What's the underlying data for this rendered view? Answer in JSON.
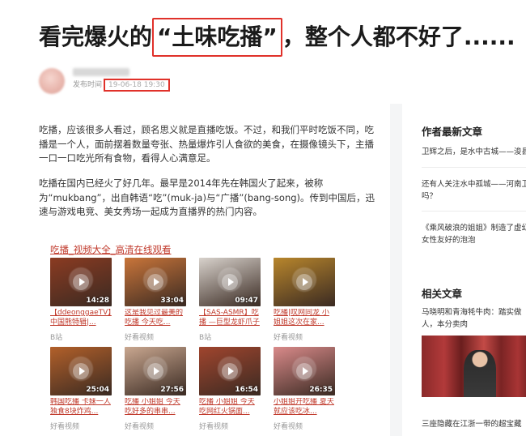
{
  "article": {
    "title_pre": "看完爆火的",
    "title_highlight": "“土味吃播”",
    "title_post": "，整个人都不好了......",
    "publish_label": "发布时间",
    "publish_time": "19-06-18  19:30",
    "paragraphs": [
      "吃播，应该很多人看过，顾名思义就是直播吃饭。不过，和我们平时吃饭不同，吃播是一个人，面前摆着数量夸张、热量爆炸引人食欲的美食，在摄像镜头下，主播一口一口吃光所有食物，看得人心满意足。",
      "吃播在国内已经火了好几年。最早是2014年先在韩国火了起来，被称为“mukbang”，出自韩语“吃”(muk-ja)与“广播”(bang-song)。传到中国后，迅速与游戏电竞、美女秀场一起成为直播界的热门内容。"
    ]
  },
  "video_section": {
    "header": "吃播_视频大全_高清在线观看",
    "videos": [
      {
        "duration": "14:28",
        "title": "【ddeonggaeTV】中国熊特辑|...",
        "source": "B站"
      },
      {
        "duration": "33:04",
        "title": "这是我见过最美的吃播 今天吃...",
        "source": "好看视频"
      },
      {
        "duration": "09:47",
        "title": "【SAS-ASMR】吃播 —巨型龙虾爪子",
        "source": "B站"
      },
      {
        "duration": "",
        "title": "吃播|叹网同龙 小姐姐这次在家...",
        "source": "好看视频"
      },
      {
        "duration": "25:04",
        "title": "韩国吃播 卡妹一人独食8块炸鸡...",
        "source": "好看视频"
      },
      {
        "duration": "27:56",
        "title": "吃播 小姐姐 今天吃好多的串串...",
        "source": "好看视频"
      },
      {
        "duration": "16:54",
        "title": "吃播 小姐姐 今天吃网红火锅面...",
        "source": "好看视频"
      },
      {
        "duration": "26:35",
        "title": "小姐姐开吃播 夏天就应该吃冰...",
        "source": "好看视频"
      }
    ],
    "thumb_colors": [
      "#8b3b22",
      "#c9753a",
      "#d8d2cc",
      "#b8862c",
      "#b2602a",
      "#c9a790",
      "#a0452e",
      "#d98a8a"
    ]
  },
  "sidebar": {
    "latest_header": "作者最新文章",
    "latest": [
      "卫辉之后，是水中古城——浚县",
      "还有人关注水中孤城——河南卫辉吗？",
      "《乘风破浪的姐姐》制造了虚幻的对女性友好的泡泡"
    ],
    "related_header": "相关文章",
    "related": [
      "马晓明和青海牦牛肉：踏实做人，本分卖肉",
      "三座隐藏在江浙一带的超宝藏"
    ]
  }
}
